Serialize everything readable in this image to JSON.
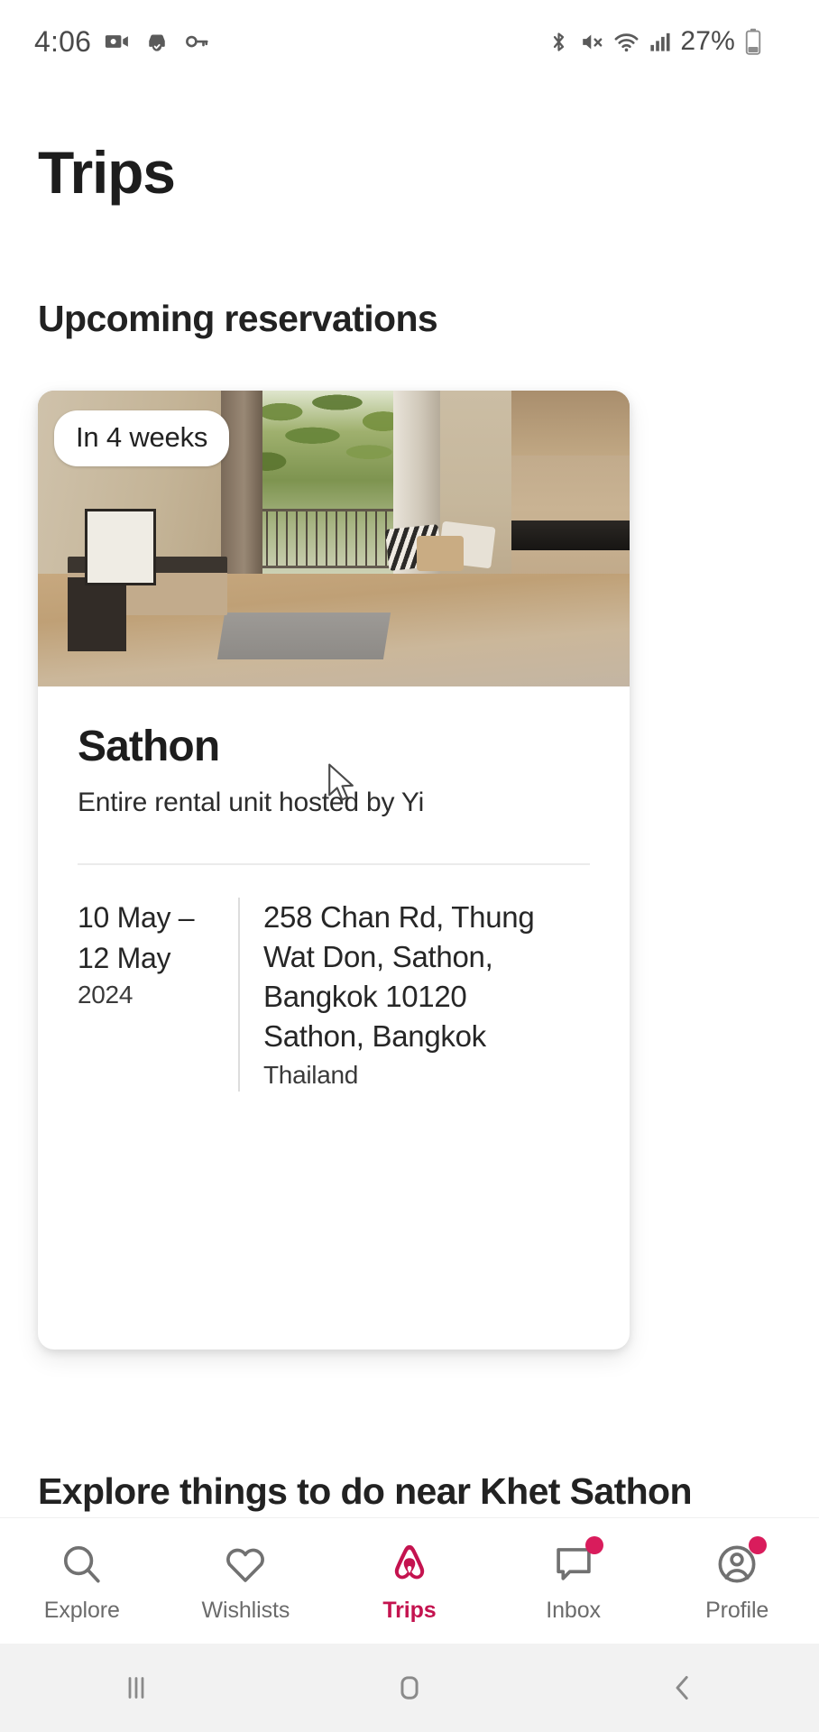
{
  "status_bar": {
    "time": "4:06",
    "battery_percent": "27%",
    "left_icons": [
      "video-camera-icon",
      "car-check-icon",
      "key-icon"
    ],
    "right_icons": [
      "bluetooth-icon",
      "volume-mute-icon",
      "wifi-icon",
      "cellular-signal-icon",
      "battery-icon"
    ]
  },
  "header": {
    "title": "Trips"
  },
  "sections": {
    "upcoming_heading": "Upcoming reservations",
    "explore_heading": "Explore things to do near Khet Sathon"
  },
  "reservation": {
    "badge": "In 4 weeks",
    "title": "Sathon",
    "subtitle": "Entire rental unit hosted by Yi",
    "date_range": "10 May – 12 May",
    "date_line_1": "10 May –",
    "date_line_2": "12 May",
    "year": "2024",
    "address_line_1": "258 Chan Rd, Thung",
    "address_line_2": "Wat Don, Sathon,",
    "address_line_3": "Bangkok 10120",
    "address_line_4": "Sathon, Bangkok",
    "country": "Thailand",
    "photo_alt": "living room with balcony, sofa and kitchenette"
  },
  "tab_bar": {
    "items": [
      {
        "label": "Explore",
        "icon": "search-icon",
        "active": false,
        "badge": false
      },
      {
        "label": "Wishlists",
        "icon": "heart-icon",
        "active": false,
        "badge": false
      },
      {
        "label": "Trips",
        "icon": "airbnb-belo-icon",
        "active": true,
        "badge": false
      },
      {
        "label": "Inbox",
        "icon": "chat-bubble-icon",
        "active": false,
        "badge": true
      },
      {
        "label": "Profile",
        "icon": "user-avatar-icon",
        "active": false,
        "badge": true
      }
    ]
  },
  "system_nav": {
    "recents_label": "Recent apps",
    "home_label": "Home",
    "back_label": "Back"
  },
  "colors": {
    "accent": "#C4134F",
    "badge_dot": "#D91C5C",
    "text_primary": "#222222",
    "text_secondary": "#6b6b6b",
    "divider": "#ebebeb",
    "sysnav_bg": "#f2f2f2"
  }
}
